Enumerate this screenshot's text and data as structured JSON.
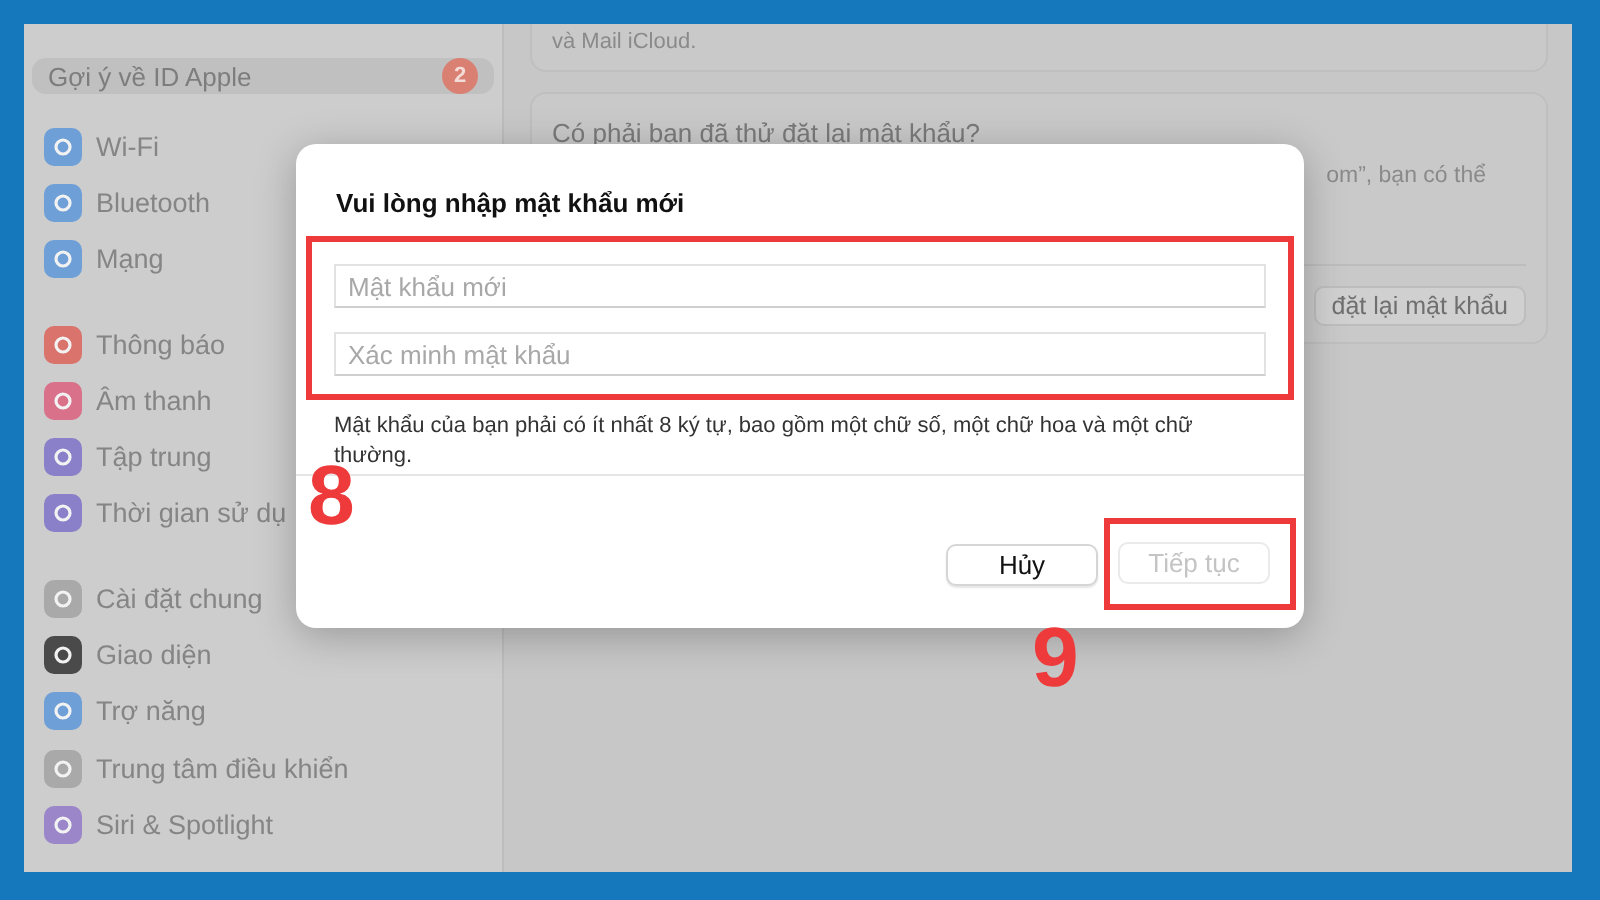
{
  "sidebar": {
    "account": {
      "label": "Gợi ý về ID Apple",
      "badge": "2"
    },
    "groups": [
      [
        {
          "label": "Wi-Fi",
          "color": "#6e9fd6"
        },
        {
          "label": "Bluetooth",
          "color": "#6e9fd6"
        },
        {
          "label": "Mạng",
          "color": "#6e9fd6"
        }
      ],
      [
        {
          "label": "Thông báo",
          "color": "#d9736c"
        },
        {
          "label": "Âm thanh",
          "color": "#d9718a"
        },
        {
          "label": "Tập trung",
          "color": "#8a80c9"
        },
        {
          "label": "Thời gian sử dụ",
          "color": "#8a80c9"
        }
      ],
      [
        {
          "label": "Cài đặt chung",
          "color": "#a9a9a9"
        },
        {
          "label": "Giao diện",
          "color": "#4a4a4a"
        },
        {
          "label": "Trợ năng",
          "color": "#6e9fd6"
        },
        {
          "label": "Trung tâm điều khiển",
          "color": "#a9a9a9"
        },
        {
          "label": "Siri & Spotlight",
          "color": "#9a86c9"
        }
      ]
    ]
  },
  "main": {
    "cards": [
      {
        "text": "và Mail iCloud."
      },
      {
        "title": "Có phải bạn đã thử đặt lại mật khẩu?",
        "text": "om”, bạn có thể",
        "button": "đặt lại mật khẩu"
      }
    ]
  },
  "dialog": {
    "title": "Vui lòng nhập mật khẩu mới",
    "fields": [
      {
        "placeholder": "Mật khẩu mới"
      },
      {
        "placeholder": "Xác minh mật khẩu"
      }
    ],
    "hint": "Mật khẩu của bạn phải có ít nhất 8 ký tự, bao gồm một chữ số, một chữ hoa và một chữ thường.",
    "buttons": [
      {
        "label": "Hủy",
        "disabled": false
      },
      {
        "label": "Tiếp tục",
        "disabled": true
      }
    ]
  },
  "annotations": [
    {
      "label": "8"
    },
    {
      "label": "9"
    }
  ]
}
